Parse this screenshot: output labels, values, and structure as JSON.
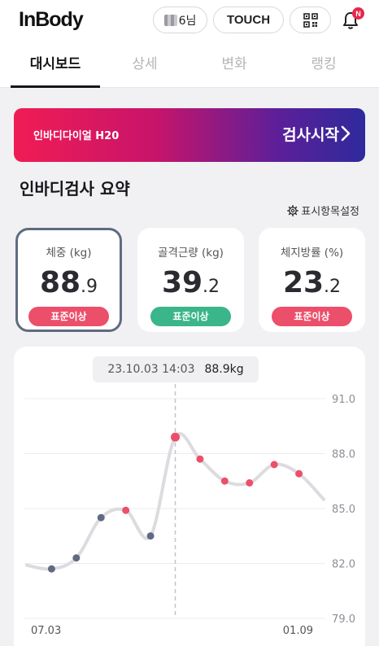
{
  "header": {
    "logo": "InBody",
    "user_suffix": "6님",
    "touch_label": "TOUCH",
    "notification_badge": "N",
    "badge_color": "#e8274b"
  },
  "tabs": [
    {
      "label": "대시보드",
      "active": true
    },
    {
      "label": "상세",
      "active": false
    },
    {
      "label": "변화",
      "active": false
    },
    {
      "label": "랭킹",
      "active": false
    }
  ],
  "banner": {
    "device_name": "인바디다이얼 H20",
    "start_label": "검사시작",
    "gradient": [
      "#f01c54",
      "#c8146a",
      "#5d1f99",
      "#2e2a9c"
    ]
  },
  "summary": {
    "title": "인바디검사 요약",
    "settings_label": "표시항목설정",
    "cards": [
      {
        "label": "체중 (kg)",
        "int": "88",
        "dec": ".9",
        "status": "표준이상",
        "status_color": "#ec4f6a",
        "selected": true
      },
      {
        "label": "골격근량 (kg)",
        "int": "39",
        "dec": ".2",
        "status": "표준이상",
        "status_color": "#3bb58a",
        "selected": false
      },
      {
        "label": "체지방률 (%)",
        "int": "23",
        "dec": ".2",
        "status": "표준이상",
        "status_color": "#ec4f6a",
        "selected": false
      }
    ]
  },
  "chart_data": {
    "type": "line",
    "title": "",
    "xlabel": "",
    "ylabel": "",
    "x_tick_labels": [
      "07.03",
      "01.09"
    ],
    "y_ticks": [
      91.0,
      88.0,
      85.0,
      82.0,
      79.0
    ],
    "y_tick_labels": [
      "91.0",
      "88.0",
      "85.0",
      "82.0",
      "79.0"
    ],
    "ylim": [
      79.0,
      91.0
    ],
    "grid": true,
    "series": [
      {
        "values": [
          81.9,
          81.7,
          82.3,
          84.5,
          84.9,
          83.5,
          88.9,
          87.7,
          86.5,
          86.4,
          87.4,
          86.9,
          85.5
        ],
        "point_colors": [
          "none",
          "#5f6b80",
          "#5f6b80",
          "#5f6b80",
          "#ec4f6a",
          "#5f6b80",
          "#ec4f6a",
          "#ec4f6a",
          "#ec4f6a",
          "#ec4f6a",
          "#ec4f6a",
          "#ec4f6a",
          "none"
        ],
        "line_color": "#dcdce0"
      }
    ],
    "selected_index": 6,
    "tooltip": {
      "date": "23.10.03 14:03",
      "value": "88.9kg"
    }
  }
}
